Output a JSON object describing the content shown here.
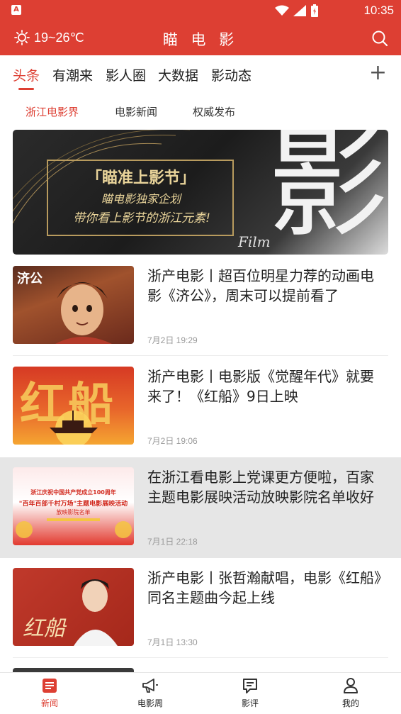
{
  "status_bar": {
    "time": "10:35",
    "app_badge": "A"
  },
  "header": {
    "weather": "19~26℃",
    "title": "瞄 电 影"
  },
  "tabs": [
    {
      "label": "头条",
      "active": true
    },
    {
      "label": "有潮来"
    },
    {
      "label": "影人圈"
    },
    {
      "label": "大数据"
    },
    {
      "label": "影动态"
    }
  ],
  "add_tab_label": "+",
  "subtabs": [
    {
      "label": "浙江电影界",
      "active": true
    },
    {
      "label": "电影新闻"
    },
    {
      "label": "权威发布"
    }
  ],
  "banner": {
    "line1": "「瞄准上影节」",
    "line2": "瞄电影独家企划",
    "line3": "带你看上影节的浙江元素!",
    "big_char": "影",
    "film_text": "Film"
  },
  "news": [
    {
      "title": "浙产电影丨超百位明星力荐的动画电影《济公》，周末可以提前看了",
      "date": "7月2日 19:29",
      "thumb_text": "济公"
    },
    {
      "title": "浙产电影丨电影版《觉醒年代》就要来了！《红船》9日上映",
      "date": "7月2日 19:06",
      "thumb_text": "红船"
    },
    {
      "title": "在浙江看电影上党课更方便啦，百家主题电影展映活动放映影院名单收好",
      "date": "7月1日 22:18",
      "thumb_line1": "浙江庆祝中国共产党成立100周年",
      "thumb_line2": "\"百年百部千村万场\"主题电影展映活动",
      "thumb_line3": "放映影院名单"
    },
    {
      "title": "浙产电影丨张哲瀚献唱，电影《红船》同名主题曲今起上线",
      "date": "7月1日 13:30",
      "thumb_text": "红船"
    }
  ],
  "bottom_nav": [
    {
      "label": "新闻",
      "icon": "news-icon",
      "active": true
    },
    {
      "label": "电影周",
      "icon": "megaphone-icon"
    },
    {
      "label": "影评",
      "icon": "comment-icon"
    },
    {
      "label": "我的",
      "icon": "person-icon"
    }
  ],
  "colors": {
    "brand": "#dd3f33",
    "text": "#222222",
    "muted": "#999999"
  }
}
